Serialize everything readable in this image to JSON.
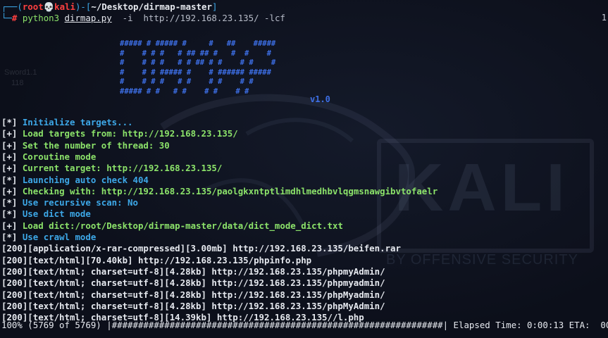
{
  "prompt": {
    "user": "root",
    "host": "kali",
    "path": "~/Desktop/dirmap-master",
    "command": "python3",
    "script": "dirmap.py",
    "args": "  -i  http://192.168.23.135/ -lcf",
    "side_number": "1"
  },
  "banner": {
    "art": [
      "##### # ##### #     #   ##    #####",
      "#    # # #   # ## ## #   #  #    #",
      "#    # # #   # # ## # #    # #    #",
      "#    # # ##### #    # ###### #####",
      "#    # # #   # #    # #    # #",
      "##### # #   # #    # #    # #"
    ],
    "version": "v1.0"
  },
  "watermark": {
    "logo": "KALI",
    "tagline": "BY OFFENSIVE SECURITY",
    "desktop_label_1": "Sword1.1",
    "desktop_label_2": "118"
  },
  "log": [
    {
      "mark": "[*]",
      "text": " Initialize targets...",
      "color": "blue"
    },
    {
      "mark": "[+]",
      "text": " Load targets from: http://192.168.23.135/",
      "color": "green"
    },
    {
      "mark": "[+]",
      "text": " Set the number of thread: 30",
      "color": "green"
    },
    {
      "mark": "[+]",
      "text": " Coroutine mode",
      "color": "green"
    },
    {
      "mark": "[+]",
      "text": " Current target: http://192.168.23.135/",
      "color": "green"
    },
    {
      "mark": "[*]",
      "text": " Launching auto check 404",
      "color": "blue"
    },
    {
      "mark": "[+]",
      "text": " Checking with: http://192.168.23.135/paolgkxntptlimdhlmedhbvlqgmsnawgibvtofaelr",
      "color": "green"
    },
    {
      "mark": "[*]",
      "text": " Use recursive scan: No",
      "color": "blue"
    },
    {
      "mark": "[*]",
      "text": " Use dict mode",
      "color": "blue"
    },
    {
      "mark": "[+]",
      "text": " Load dict:/root/Desktop/dirmap-master/data/dict_mode_dict.txt",
      "color": "green"
    },
    {
      "mark": "[*]",
      "text": " Use crawl mode",
      "color": "blue"
    }
  ],
  "results": [
    "[200][application/x-rar-compressed][3.00mb] http://192.168.23.135/beifen.rar",
    "[200][text/html][70.40kb] http://192.168.23.135/phpinfo.php",
    "[200][text/html; charset=utf-8][4.28kb] http://192.168.23.135/phpmyAdmin/",
    "[200][text/html; charset=utf-8][4.28kb] http://192.168.23.135/phpmyadmin/",
    "[200][text/html; charset=utf-8][4.28kb] http://192.168.23.135/phpMyadmin/",
    "[200][text/html; charset=utf-8][4.28kb] http://192.168.23.135/phpMyAdmin/",
    "[200][text/html; charset=utf-8][14.39kb] http://192.168.23.135//l.php"
  ],
  "progress": {
    "percent": "100% (5769 of 5769) |",
    "bar": "###############################################################|",
    "tail": " Elapsed Time: 0:00:13 ETA:  00:0"
  },
  "colors": {
    "blue": "#3da8e8",
    "green": "#8ce36a",
    "red": "#ff4040",
    "banner": "#3d6fe6",
    "background": "#0c0f1a"
  }
}
